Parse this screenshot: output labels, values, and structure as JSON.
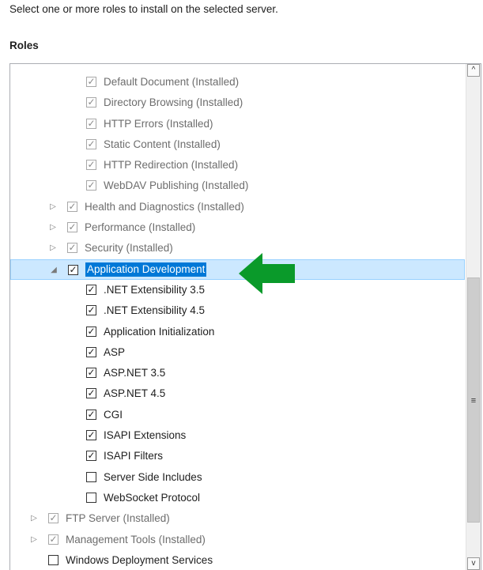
{
  "instruction": "Select one or more roles to install on the selected server.",
  "section_title": "Roles",
  "roles": [
    {
      "label": "Default Document (Installed)",
      "indent": 2,
      "expander": "",
      "checked": true,
      "installed": true
    },
    {
      "label": "Directory Browsing (Installed)",
      "indent": 2,
      "expander": "",
      "checked": true,
      "installed": true
    },
    {
      "label": "HTTP Errors (Installed)",
      "indent": 2,
      "expander": "",
      "checked": true,
      "installed": true
    },
    {
      "label": "Static Content (Installed)",
      "indent": 2,
      "expander": "",
      "checked": true,
      "installed": true
    },
    {
      "label": "HTTP Redirection (Installed)",
      "indent": 2,
      "expander": "",
      "checked": true,
      "installed": true
    },
    {
      "label": "WebDAV Publishing (Installed)",
      "indent": 2,
      "expander": "",
      "checked": true,
      "installed": true
    },
    {
      "label": "Health and Diagnostics (Installed)",
      "indent": 1,
      "expander": "collapsed",
      "checked": true,
      "installed": true
    },
    {
      "label": "Performance (Installed)",
      "indent": 1,
      "expander": "collapsed",
      "checked": true,
      "installed": true
    },
    {
      "label": "Security (Installed)",
      "indent": 1,
      "expander": "collapsed",
      "checked": true,
      "installed": true
    },
    {
      "label": "Application Development",
      "indent": 1,
      "expander": "expanded",
      "checked": true,
      "installed": false,
      "selected": true
    },
    {
      "label": ".NET Extensibility 3.5",
      "indent": 2,
      "expander": "",
      "checked": true,
      "installed": false
    },
    {
      "label": ".NET Extensibility 4.5",
      "indent": 2,
      "expander": "",
      "checked": true,
      "installed": false
    },
    {
      "label": "Application Initialization",
      "indent": 2,
      "expander": "",
      "checked": true,
      "installed": false
    },
    {
      "label": "ASP",
      "indent": 2,
      "expander": "",
      "checked": true,
      "installed": false
    },
    {
      "label": "ASP.NET 3.5",
      "indent": 2,
      "expander": "",
      "checked": true,
      "installed": false
    },
    {
      "label": "ASP.NET 4.5",
      "indent": 2,
      "expander": "",
      "checked": true,
      "installed": false
    },
    {
      "label": "CGI",
      "indent": 2,
      "expander": "",
      "checked": true,
      "installed": false
    },
    {
      "label": "ISAPI Extensions",
      "indent": 2,
      "expander": "",
      "checked": true,
      "installed": false
    },
    {
      "label": "ISAPI Filters",
      "indent": 2,
      "expander": "",
      "checked": true,
      "installed": false
    },
    {
      "label": "Server Side Includes",
      "indent": 2,
      "expander": "",
      "checked": false,
      "installed": false
    },
    {
      "label": "WebSocket Protocol",
      "indent": 2,
      "expander": "",
      "checked": false,
      "installed": false
    },
    {
      "label": "FTP Server (Installed)",
      "indent": 0,
      "expander": "collapsed",
      "checked": true,
      "installed": true
    },
    {
      "label": "Management Tools (Installed)",
      "indent": 0,
      "expander": "collapsed",
      "checked": true,
      "installed": true
    },
    {
      "label": "Windows Deployment Services",
      "indent": 0,
      "expander": "",
      "checked": false,
      "installed": false
    }
  ],
  "icons": {
    "expander_collapsed": "▷",
    "expander_expanded": "◢",
    "checkmark": "✓",
    "scroll_up": "^",
    "scroll_down": "v",
    "scroll_grip": "≡",
    "annotation_arrow": "green-left-arrow"
  },
  "colors": {
    "selection_fill": "#cce8ff",
    "selection_text_bg": "#0078d7",
    "arrow": "#0a9a2a"
  }
}
